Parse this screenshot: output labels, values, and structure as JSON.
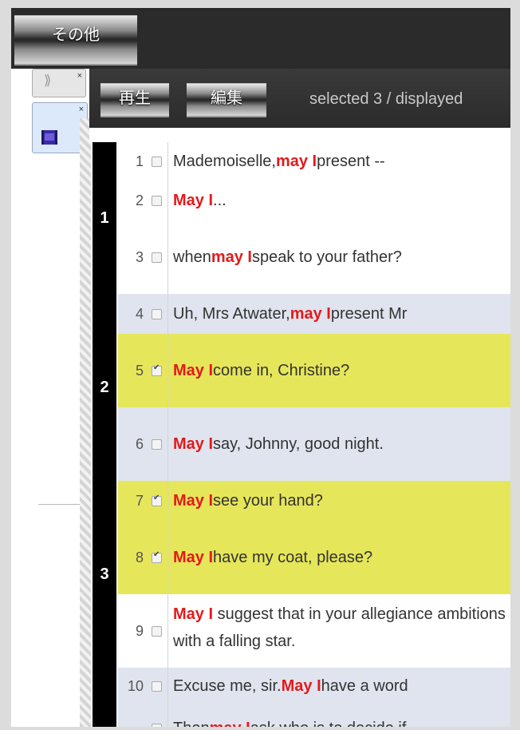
{
  "menu": {
    "other_label": "その他"
  },
  "tabs": {
    "collapse_glyph": "⟫",
    "close_glyph": "×"
  },
  "panel": {
    "play_label": "再生",
    "edit_label": "編集",
    "selection_info": "selected 3 / displayed"
  },
  "groups": [
    {
      "label": "1"
    },
    {
      "label": "2"
    },
    {
      "label": "3"
    }
  ],
  "rows": [
    {
      "num": "1",
      "checked": false,
      "state": "odd",
      "parts": [
        [
          "Mademoiselle, ",
          false
        ],
        [
          "may I",
          true
        ],
        [
          " present --",
          false
        ]
      ]
    },
    {
      "num": "2",
      "checked": false,
      "state": "odd",
      "parts": [
        [
          "May I",
          true
        ],
        [
          "...",
          false
        ]
      ]
    },
    {
      "num": "3",
      "checked": false,
      "state": "odd",
      "parts": [
        [
          "when ",
          false
        ],
        [
          "may I",
          true
        ],
        [
          " speak to your father?",
          false
        ]
      ]
    },
    {
      "num": "4",
      "checked": false,
      "state": "even",
      "parts": [
        [
          "Uh, Mrs Atwater, ",
          false
        ],
        [
          "may I",
          true
        ],
        [
          " present Mr",
          false
        ]
      ]
    },
    {
      "num": "5",
      "checked": true,
      "state": "sel",
      "parts": [
        [
          "May I",
          true
        ],
        [
          " come in, Christine?",
          false
        ]
      ]
    },
    {
      "num": "6",
      "checked": false,
      "state": "even",
      "parts": [
        [
          "May I",
          true
        ],
        [
          " say, Johnny, good night.",
          false
        ]
      ]
    },
    {
      "num": "7",
      "checked": true,
      "state": "sel",
      "parts": [
        [
          "May I",
          true
        ],
        [
          " see your hand?",
          false
        ]
      ]
    },
    {
      "num": "8",
      "checked": true,
      "state": "sel",
      "parts": [
        [
          "May I",
          true
        ],
        [
          " have my coat, please?",
          false
        ]
      ]
    },
    {
      "num": "9",
      "checked": false,
      "state": "odd",
      "parts": [
        [
          "May I",
          true
        ],
        [
          " suggest that in your allegiance ambitions with a falling star.",
          false
        ]
      ]
    },
    {
      "num": "10",
      "checked": false,
      "state": "even",
      "parts": [
        [
          "Excuse me, sir. ",
          false
        ],
        [
          "May I",
          true
        ],
        [
          " have a word",
          false
        ]
      ]
    },
    {
      "num": "",
      "checked": false,
      "state": "even",
      "parts": [
        [
          "Then ",
          false
        ],
        [
          "may I",
          true
        ],
        [
          " ask who is to decide if",
          false
        ]
      ]
    }
  ],
  "colors": {
    "highlight": "#e31a1c",
    "selected_row": "#e6e65a",
    "group_bar": "#000000"
  }
}
